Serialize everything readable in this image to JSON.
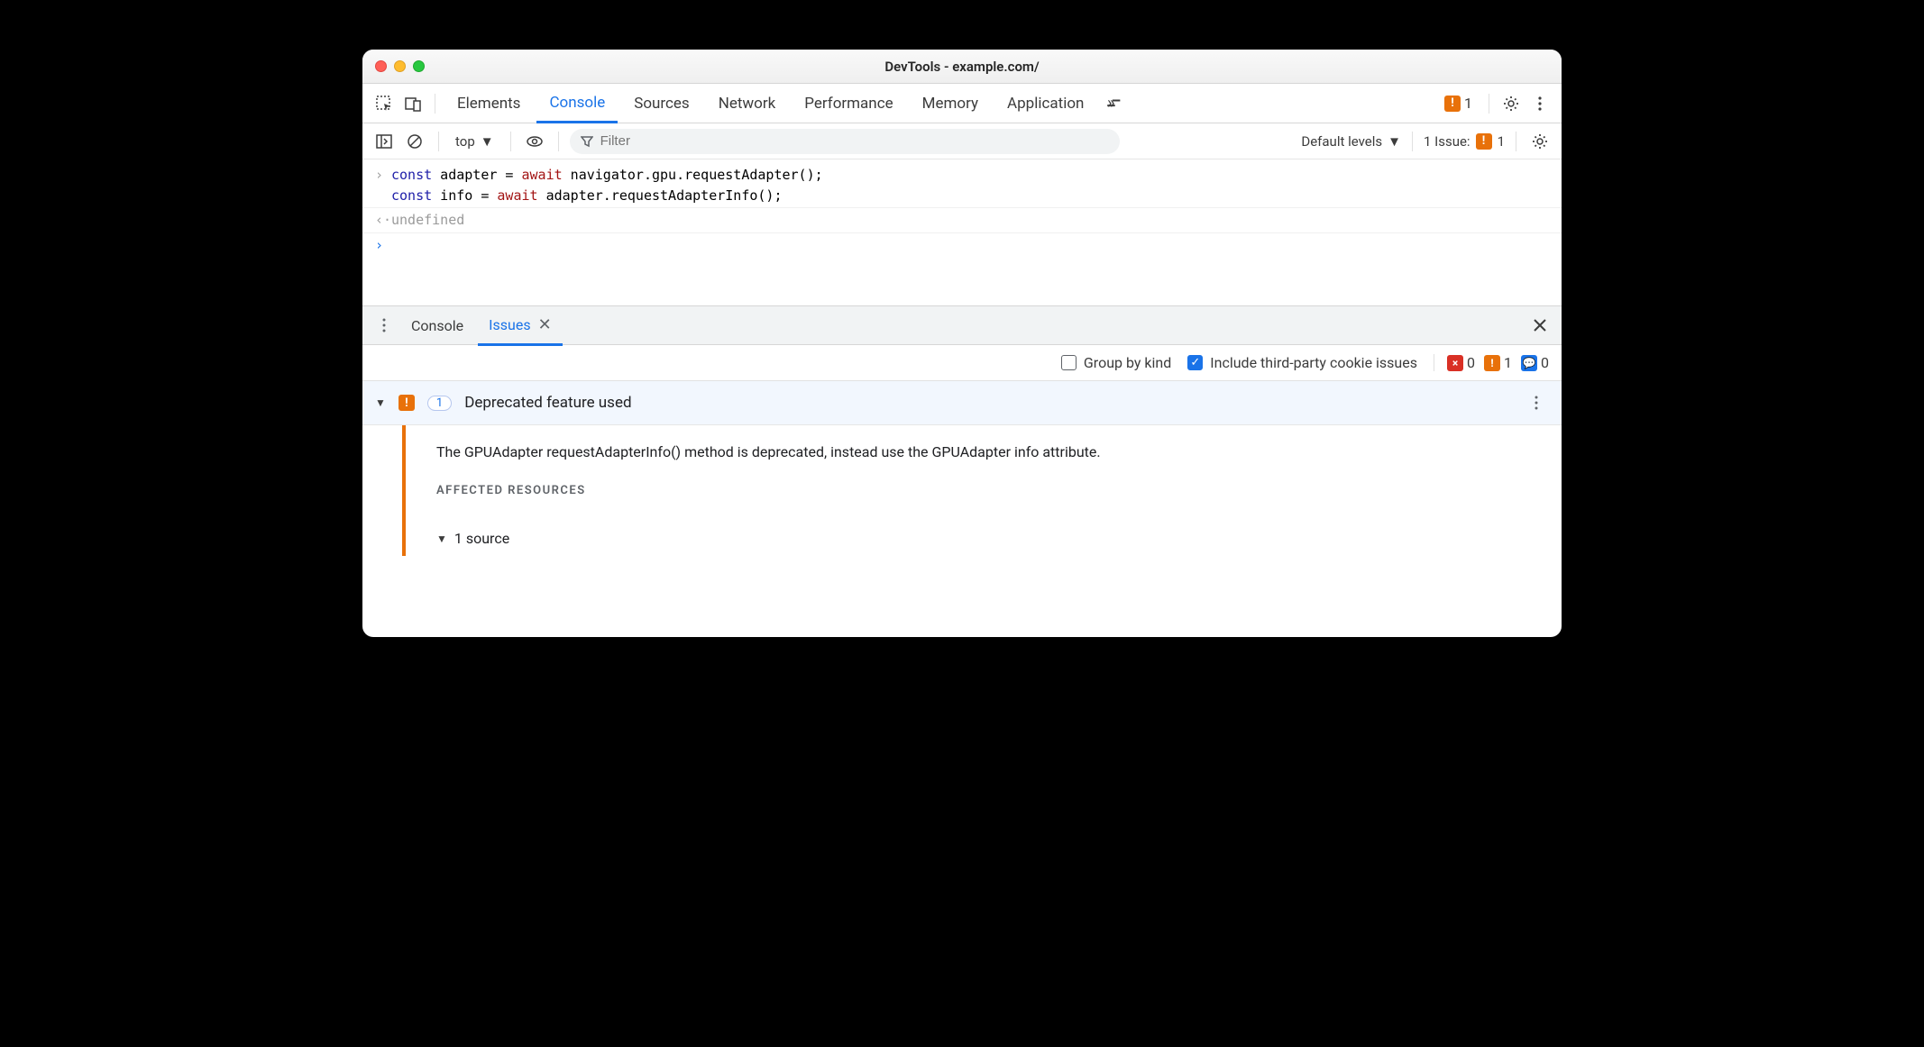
{
  "window_title": "DevTools - example.com/",
  "tabs": {
    "elements": "Elements",
    "console": "Console",
    "sources": "Sources",
    "network": "Network",
    "performance": "Performance",
    "memory": "Memory",
    "application": "Application"
  },
  "top_issue_count": "1",
  "console_toolbar": {
    "context": "top",
    "filter_placeholder": "Filter",
    "levels": "Default levels",
    "issue_label": "1 Issue:",
    "issue_count": "1"
  },
  "console": {
    "line1": "const adapter = await navigator.gpu.requestAdapter();",
    "line2": "const info = await adapter.requestAdapterInfo();",
    "output": "undefined"
  },
  "drawer": {
    "console": "Console",
    "issues": "Issues"
  },
  "issues_toolbar": {
    "group_label": "Group by kind",
    "third_party_label": "Include third-party cookie issues",
    "count_red": "0",
    "count_orange": "1",
    "count_blue": "0"
  },
  "issue": {
    "category_count": "1",
    "title": "Deprecated feature used",
    "body": "The GPUAdapter requestAdapterInfo() method is deprecated, instead use the GPUAdapter info attribute.",
    "affected_label": "AFFECTED RESOURCES",
    "source_line": "1 source"
  }
}
